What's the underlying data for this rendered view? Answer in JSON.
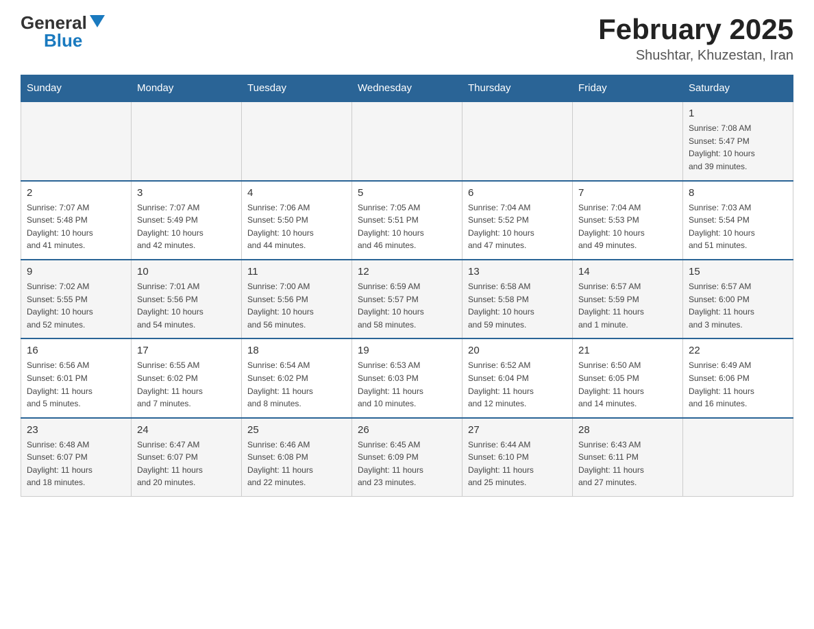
{
  "header": {
    "logo_general": "General",
    "logo_blue": "Blue",
    "month_title": "February 2025",
    "location": "Shushtar, Khuzestan, Iran"
  },
  "weekdays": [
    "Sunday",
    "Monday",
    "Tuesday",
    "Wednesday",
    "Thursday",
    "Friday",
    "Saturday"
  ],
  "weeks": [
    {
      "shaded": true,
      "days": [
        {
          "date": "",
          "info": ""
        },
        {
          "date": "",
          "info": ""
        },
        {
          "date": "",
          "info": ""
        },
        {
          "date": "",
          "info": ""
        },
        {
          "date": "",
          "info": ""
        },
        {
          "date": "",
          "info": ""
        },
        {
          "date": "1",
          "info": "Sunrise: 7:08 AM\nSunset: 5:47 PM\nDaylight: 10 hours\nand 39 minutes."
        }
      ]
    },
    {
      "shaded": false,
      "days": [
        {
          "date": "2",
          "info": "Sunrise: 7:07 AM\nSunset: 5:48 PM\nDaylight: 10 hours\nand 41 minutes."
        },
        {
          "date": "3",
          "info": "Sunrise: 7:07 AM\nSunset: 5:49 PM\nDaylight: 10 hours\nand 42 minutes."
        },
        {
          "date": "4",
          "info": "Sunrise: 7:06 AM\nSunset: 5:50 PM\nDaylight: 10 hours\nand 44 minutes."
        },
        {
          "date": "5",
          "info": "Sunrise: 7:05 AM\nSunset: 5:51 PM\nDaylight: 10 hours\nand 46 minutes."
        },
        {
          "date": "6",
          "info": "Sunrise: 7:04 AM\nSunset: 5:52 PM\nDaylight: 10 hours\nand 47 minutes."
        },
        {
          "date": "7",
          "info": "Sunrise: 7:04 AM\nSunset: 5:53 PM\nDaylight: 10 hours\nand 49 minutes."
        },
        {
          "date": "8",
          "info": "Sunrise: 7:03 AM\nSunset: 5:54 PM\nDaylight: 10 hours\nand 51 minutes."
        }
      ]
    },
    {
      "shaded": true,
      "days": [
        {
          "date": "9",
          "info": "Sunrise: 7:02 AM\nSunset: 5:55 PM\nDaylight: 10 hours\nand 52 minutes."
        },
        {
          "date": "10",
          "info": "Sunrise: 7:01 AM\nSunset: 5:56 PM\nDaylight: 10 hours\nand 54 minutes."
        },
        {
          "date": "11",
          "info": "Sunrise: 7:00 AM\nSunset: 5:56 PM\nDaylight: 10 hours\nand 56 minutes."
        },
        {
          "date": "12",
          "info": "Sunrise: 6:59 AM\nSunset: 5:57 PM\nDaylight: 10 hours\nand 58 minutes."
        },
        {
          "date": "13",
          "info": "Sunrise: 6:58 AM\nSunset: 5:58 PM\nDaylight: 10 hours\nand 59 minutes."
        },
        {
          "date": "14",
          "info": "Sunrise: 6:57 AM\nSunset: 5:59 PM\nDaylight: 11 hours\nand 1 minute."
        },
        {
          "date": "15",
          "info": "Sunrise: 6:57 AM\nSunset: 6:00 PM\nDaylight: 11 hours\nand 3 minutes."
        }
      ]
    },
    {
      "shaded": false,
      "days": [
        {
          "date": "16",
          "info": "Sunrise: 6:56 AM\nSunset: 6:01 PM\nDaylight: 11 hours\nand 5 minutes."
        },
        {
          "date": "17",
          "info": "Sunrise: 6:55 AM\nSunset: 6:02 PM\nDaylight: 11 hours\nand 7 minutes."
        },
        {
          "date": "18",
          "info": "Sunrise: 6:54 AM\nSunset: 6:02 PM\nDaylight: 11 hours\nand 8 minutes."
        },
        {
          "date": "19",
          "info": "Sunrise: 6:53 AM\nSunset: 6:03 PM\nDaylight: 11 hours\nand 10 minutes."
        },
        {
          "date": "20",
          "info": "Sunrise: 6:52 AM\nSunset: 6:04 PM\nDaylight: 11 hours\nand 12 minutes."
        },
        {
          "date": "21",
          "info": "Sunrise: 6:50 AM\nSunset: 6:05 PM\nDaylight: 11 hours\nand 14 minutes."
        },
        {
          "date": "22",
          "info": "Sunrise: 6:49 AM\nSunset: 6:06 PM\nDaylight: 11 hours\nand 16 minutes."
        }
      ]
    },
    {
      "shaded": true,
      "days": [
        {
          "date": "23",
          "info": "Sunrise: 6:48 AM\nSunset: 6:07 PM\nDaylight: 11 hours\nand 18 minutes."
        },
        {
          "date": "24",
          "info": "Sunrise: 6:47 AM\nSunset: 6:07 PM\nDaylight: 11 hours\nand 20 minutes."
        },
        {
          "date": "25",
          "info": "Sunrise: 6:46 AM\nSunset: 6:08 PM\nDaylight: 11 hours\nand 22 minutes."
        },
        {
          "date": "26",
          "info": "Sunrise: 6:45 AM\nSunset: 6:09 PM\nDaylight: 11 hours\nand 23 minutes."
        },
        {
          "date": "27",
          "info": "Sunrise: 6:44 AM\nSunset: 6:10 PM\nDaylight: 11 hours\nand 25 minutes."
        },
        {
          "date": "28",
          "info": "Sunrise: 6:43 AM\nSunset: 6:11 PM\nDaylight: 11 hours\nand 27 minutes."
        },
        {
          "date": "",
          "info": ""
        }
      ]
    }
  ]
}
